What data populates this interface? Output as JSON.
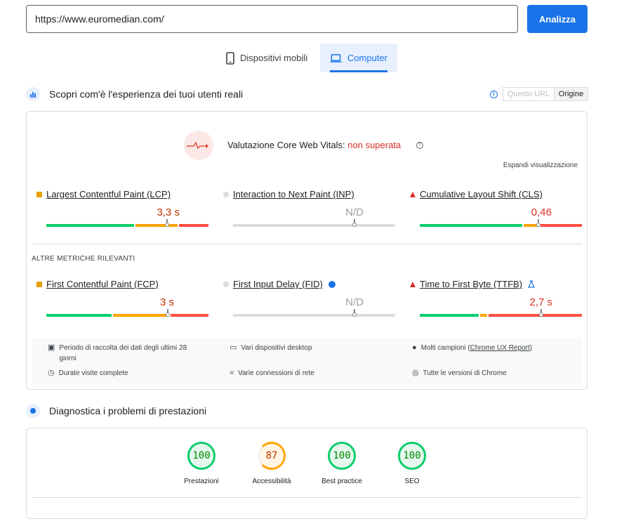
{
  "search": {
    "url": "https://www.euromedian.com/",
    "analyze_label": "Analizza"
  },
  "tabs": [
    {
      "label": "Dispositivi mobili",
      "icon": "smartphone-icon"
    },
    {
      "label": "Computer",
      "icon": "laptop-icon",
      "active": true
    }
  ],
  "field": {
    "title": "Scopri com'è l'esperienza dei tuoi utenti reali",
    "toggle": {
      "url": "Questo URL",
      "origin": "Origine",
      "selected": "Origine"
    },
    "cwv": {
      "prefix": "Valutazione Core Web Vitals: ",
      "status": "non superata"
    },
    "expand": "Espandi visualizzazione",
    "core_metrics": [
      {
        "label": "Largest Contentful Paint (LCP)",
        "value": "3,3 s",
        "rating": "average",
        "marker": 0.74,
        "color": "#c33300"
      },
      {
        "label": "Interaction to Next Paint (INP)",
        "value": "N/D",
        "rating": "none",
        "marker": 0.74,
        "color": "#9aa0a6"
      },
      {
        "label": "Cumulative Layout Shift (CLS)",
        "value": "0,46",
        "rating": "poor",
        "marker": 0.72,
        "color": "#d93025"
      }
    ],
    "other_title": "ALTRE METRICHE RILEVANTI",
    "other_metrics": [
      {
        "label": "First Contentful Paint (FCP)",
        "value": "3 s",
        "rating": "average",
        "marker": 0.74,
        "color": "#c33300"
      },
      {
        "label": "First Input Delay (FID)",
        "value": "N/D",
        "rating": "none",
        "marker": 0.74,
        "color": "#9aa0a6"
      },
      {
        "label": "Time to First Byte (TTFB)",
        "value": "2,7 s",
        "rating": "poor",
        "marker": 0.74,
        "color": "#d93025"
      }
    ],
    "info": {
      "period": "Periodo di raccolta dei dati degli ultimi 28 giorni",
      "devices": "Vari dispositivi desktop",
      "samples_prefix": "Molti campioni (",
      "samples_link": "Chrome UX Report",
      "samples_suffix": ")",
      "duration": "Durate visite complete",
      "network": "Varie connessioni di rete",
      "chrome": "Tutte le versioni di Chrome"
    }
  },
  "lab": {
    "title": "Diagnostica i problemi di prestazioni",
    "scores": [
      {
        "label": "Prestazioni",
        "value": "100",
        "rating": "good"
      },
      {
        "label": "Accessibilità",
        "value": "87",
        "rating": "average"
      },
      {
        "label": "Best practice",
        "value": "100",
        "rating": "good"
      },
      {
        "label": "SEO",
        "value": "100",
        "rating": "good"
      }
    ]
  },
  "colors": {
    "good": "#0cce6b",
    "average": "#ffa400",
    "poor": "#ff4e42",
    "accent": "#1a73e8"
  }
}
